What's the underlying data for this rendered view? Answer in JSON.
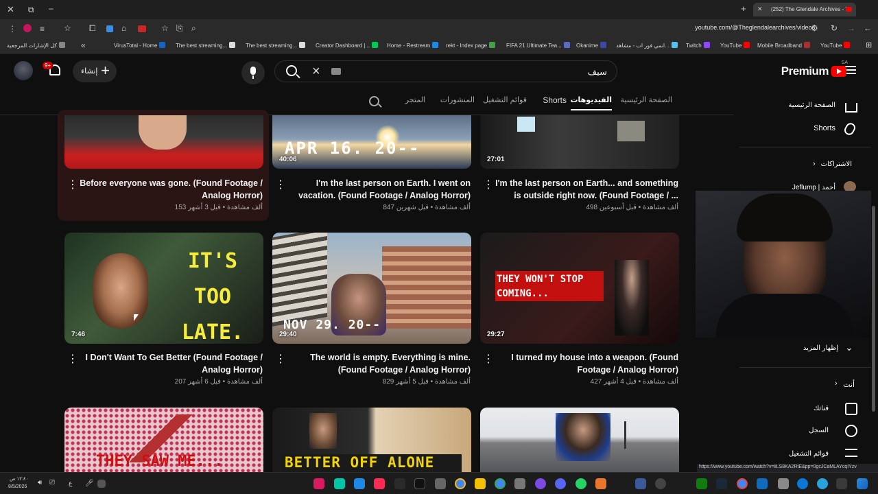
{
  "browser": {
    "tab_title": "(252) The Glendale Archives - Y",
    "url": "youtube.com/@Theglendalearchives/videos",
    "bookmarks": [
      "YouTube",
      "Mobile Broadband",
      "YouTube",
      "Twitch",
      "انمي فور اب - مشاهد...",
      "Okanime",
      "FIFA 21 Ultimate Tea...",
      "rekt - Index page",
      "Home - Restream",
      "Creator Dashboard |...",
      "The best streaming...",
      "The best streaming...",
      "VirusTotal - Home",
      "كل الإشارات المرجعية"
    ]
  },
  "header": {
    "logo_text": "Premium",
    "region": "SA",
    "search_query": "سيف",
    "create_label": "إنشاء",
    "notif_count": "9+"
  },
  "channel_tabs": [
    "الصفحة الرئيسية",
    "الفيديوهات",
    "Shorts",
    "قوائم التشغيل",
    "المنشورات",
    "المتجر"
  ],
  "videos": [
    {
      "title": "Before everyone was gone. (Found Footage / Analog Horror)",
      "meta": "153 ألف مشاهدة • قبل 3 أشهر",
      "duration": ""
    },
    {
      "title": "I'm the last person on Earth. I went on vacation. (Found Footage / Analog Horror)",
      "meta": "847 ألف مشاهدة • قبل شهرين",
      "duration": "40:06",
      "overlay": "APR 16. 20--"
    },
    {
      "title": "I'm the last person on Earth... and something is outside right now. (Found Footage / ...",
      "meta": "498 ألف مشاهدة • قبل أسبوعين",
      "duration": "27:01"
    },
    {
      "title": "I Don't Want To Get Better (Found Footage / Analog Horror)",
      "meta": "207 ألف مشاهدة • قبل 6 أشهر",
      "duration": "7:46",
      "overlay": "IT'S TOO LATE."
    },
    {
      "title": "The world is empty. Everything is mine. (Found Footage / Analog Horror)",
      "meta": "829 ألف مشاهدة • قبل 5 أشهر",
      "duration": "29:40",
      "overlay": "NOV 29. 20--"
    },
    {
      "title": "I turned my house into a weapon. (Found Footage / Analog Horror)",
      "meta": "427 ألف مشاهدة • قبل 4 أشهر",
      "duration": "29:27",
      "overlay": "THEY WON'T STOP COMING..."
    },
    {
      "title": "",
      "meta": "",
      "duration": "",
      "overlay": "THEY SAW ME..."
    },
    {
      "title": "",
      "meta": "",
      "duration": "",
      "overlay": "BETTER OFF ALONE"
    },
    {
      "title": "",
      "meta": "",
      "duration": ""
    }
  ],
  "sidebar": {
    "home": "الصفحة الرئيسية",
    "shorts": "Shorts",
    "subscriptions": "الاشتراكات",
    "sub_channel": "Jeflump | أحمد",
    "show_more": "إظهار المزيد",
    "you": "أنت",
    "your_channel": "قناتك",
    "history": "السجل",
    "playlists": "قوائم التشغيل"
  },
  "status_url": "https://www.youtube.com/watch?v=iiLS8KA2RtE&pp=0gcJCaMLAYcqIYzv",
  "taskbar": {
    "time": "١٢:٤٠ ص",
    "date": "8/5/2026",
    "lang": "ع"
  }
}
